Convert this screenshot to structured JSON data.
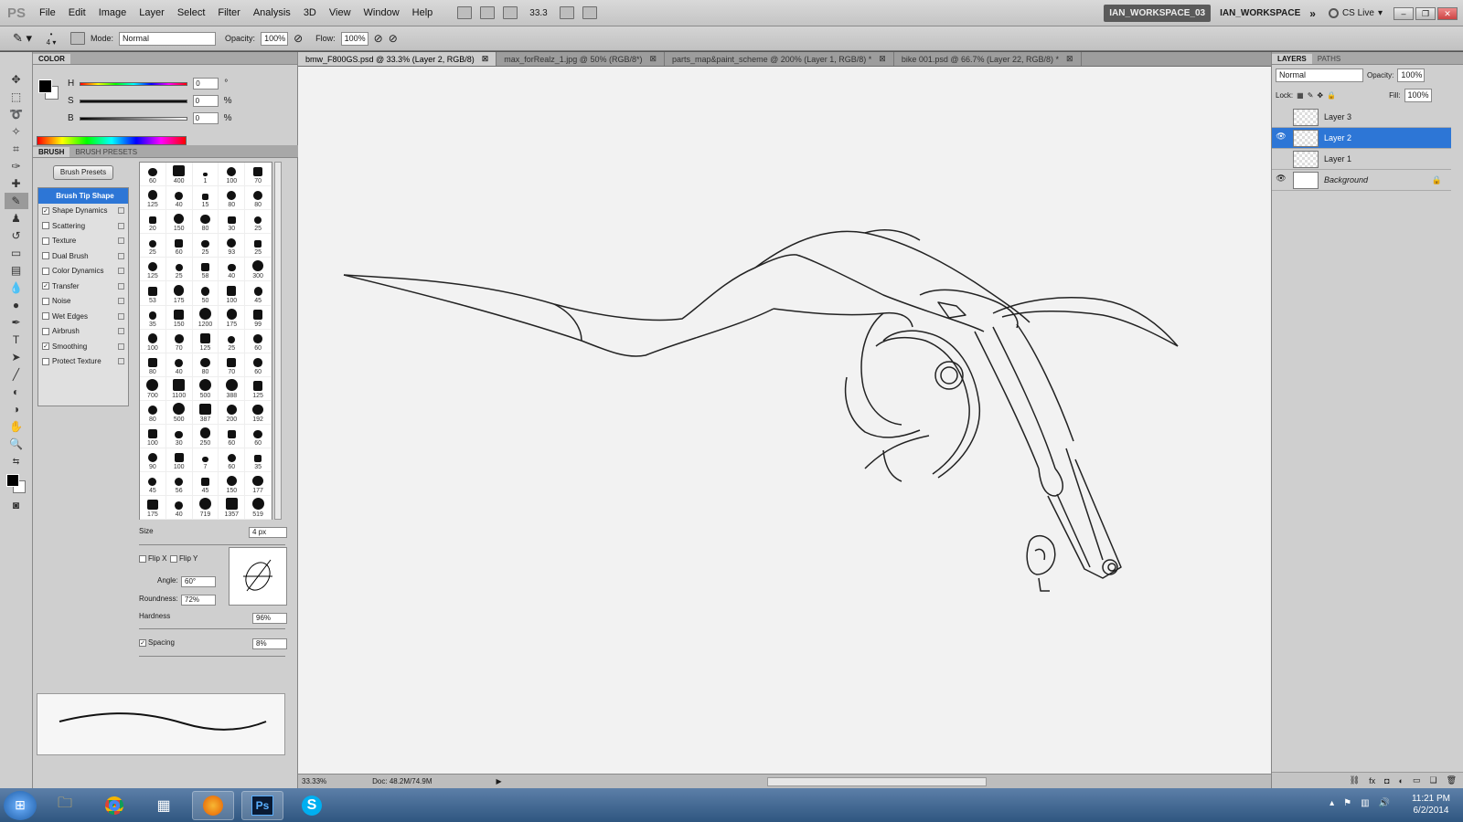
{
  "app": {
    "logo": "PS"
  },
  "menu": [
    "File",
    "Edit",
    "Image",
    "Layer",
    "Select",
    "Filter",
    "Analysis",
    "3D",
    "View",
    "Window",
    "Help"
  ],
  "menubar": {
    "zoom": "33.3",
    "workspace_active": "IAN_WORKSPACE_03",
    "workspace": "IAN_WORKSPACE",
    "cs_live": "CS Live"
  },
  "options": {
    "brush_size": "4",
    "mode_label": "Mode:",
    "mode": "Normal",
    "opacity_label": "Opacity:",
    "opacity": "100%",
    "flow_label": "Flow:",
    "flow": "100%"
  },
  "color_panel": {
    "tab": "COLOR",
    "h_label": "H",
    "h": "0",
    "s_label": "S",
    "s": "0",
    "b_label": "B",
    "b": "0",
    "deg": "°",
    "pct": "%"
  },
  "brush_panel": {
    "tabs": [
      "BRUSH",
      "BRUSH PRESETS"
    ],
    "presets_button": "Brush Presets",
    "list": [
      {
        "label": "Brush Tip Shape",
        "checked": null,
        "selected": true
      },
      {
        "label": "Shape Dynamics",
        "checked": true
      },
      {
        "label": "Scattering",
        "checked": false
      },
      {
        "label": "Texture",
        "checked": false
      },
      {
        "label": "Dual Brush",
        "checked": false
      },
      {
        "label": "Color Dynamics",
        "checked": false
      },
      {
        "label": "Transfer",
        "checked": true
      },
      {
        "label": "Noise",
        "checked": false
      },
      {
        "label": "Wet Edges",
        "checked": false
      },
      {
        "label": "Airbrush",
        "checked": false
      },
      {
        "label": "Smoothing",
        "checked": true
      },
      {
        "label": "Protect Texture",
        "checked": false
      }
    ],
    "tips": [
      "60",
      "400",
      "1",
      "100",
      "70",
      "125",
      "40",
      "15",
      "80",
      "80",
      "20",
      "150",
      "80",
      "30",
      "25",
      "25",
      "60",
      "25",
      "93",
      "25",
      "125",
      "25",
      "58",
      "40",
      "300",
      "53",
      "175",
      "50",
      "100",
      "45",
      "35",
      "150",
      "1200",
      "175",
      "99",
      "100",
      "70",
      "125",
      "25",
      "60",
      "80",
      "40",
      "80",
      "70",
      "60",
      "700",
      "1100",
      "500",
      "388",
      "125",
      "80",
      "500",
      "387",
      "200",
      "192",
      "100",
      "30",
      "250",
      "60",
      "60",
      "90",
      "100",
      "7",
      "60",
      "35",
      "45",
      "56",
      "45",
      "150",
      "177",
      "175",
      "40",
      "719",
      "1357",
      "519"
    ],
    "size_label": "Size",
    "size": "4 px",
    "flipx": "Flip X",
    "flipy": "Flip Y",
    "angle_label": "Angle:",
    "angle": "60°",
    "roundness_label": "Roundness:",
    "roundness": "72%",
    "hardness_label": "Hardness",
    "hardness": "96%",
    "spacing_label": "Spacing",
    "spacing": "8%"
  },
  "documents": [
    {
      "title": "bmw_F800GS.psd @ 33.3% (Layer 2, RGB/8)",
      "active": true
    },
    {
      "title": "max_forRealz_1.jpg @ 50% (RGB/8*)",
      "active": false
    },
    {
      "title": "parts_map&paint_scheme @ 200% (Layer 1, RGB/8) *",
      "active": false
    },
    {
      "title": "bike 001.psd @ 66.7% (Layer 22, RGB/8) *",
      "active": false
    }
  ],
  "status": {
    "zoom": "33.33%",
    "doc": "Doc: 48.2M/74.9M"
  },
  "layers_panel": {
    "tabs": [
      "LAYERS",
      "PATHS"
    ],
    "blend": "Normal",
    "opacity_label": "Opacity:",
    "opacity": "100%",
    "lock_label": "Lock:",
    "fill_label": "Fill:",
    "fill": "100%",
    "layers": [
      {
        "name": "Layer 3",
        "visible": false,
        "selected": false
      },
      {
        "name": "Layer 2",
        "visible": true,
        "selected": true
      },
      {
        "name": "Layer 1",
        "visible": false,
        "selected": false
      },
      {
        "name": "Background",
        "visible": true,
        "selected": false
      }
    ]
  },
  "taskbar": {
    "time": "11:21 PM",
    "date": "6/2/2014",
    "ps_label": "Ps",
    "skype_label": "S"
  }
}
